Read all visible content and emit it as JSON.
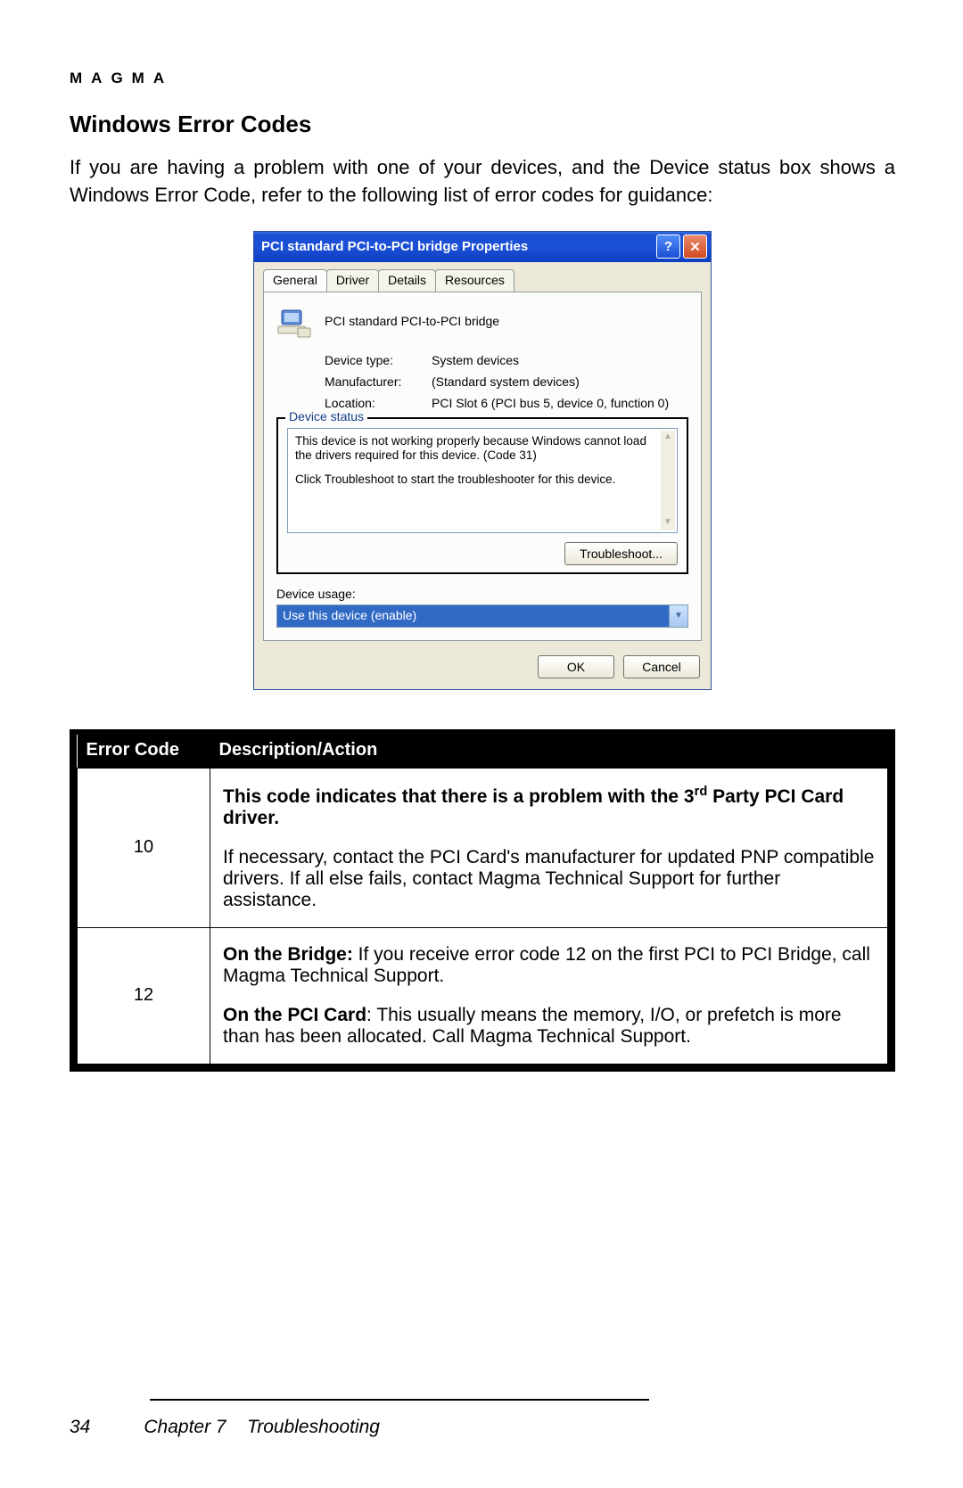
{
  "brand": "MAGMA",
  "section_title": "Windows Error Codes",
  "intro": "If you are having a problem with one of your devices, and the Device status box shows a Windows Error Code, refer to the following list of error codes for guidance:",
  "dialog": {
    "title": "PCI standard PCI-to-PCI bridge Properties",
    "tabs": [
      "General",
      "Driver",
      "Details",
      "Resources"
    ],
    "device_name": "PCI standard PCI-to-PCI bridge",
    "fields": {
      "device_type_label": "Device type:",
      "device_type_value": "System devices",
      "manufacturer_label": "Manufacturer:",
      "manufacturer_value": "(Standard system devices)",
      "location_label": "Location:",
      "location_value": "PCI Slot 6 (PCI bus 5, device 0, function 0)"
    },
    "status_group_label": "Device status",
    "status_line1": "This device is not working properly because Windows cannot load the drivers required for this device. (Code 31)",
    "status_line2": "Click Troubleshoot to start the troubleshooter for this device.",
    "troubleshoot_label": "Troubleshoot...",
    "usage_label": "Device usage:",
    "usage_value": "Use this device (enable)",
    "ok_label": "OK",
    "cancel_label": "Cancel"
  },
  "table": {
    "header_code": "Error Code",
    "header_desc": "Description/Action",
    "rows": [
      {
        "code": "10",
        "bold_a": "This code indicates that there is a problem with the 3",
        "bold_sup": "rd",
        "bold_b": " Party PCI Card driver.",
        "body": "If necessary, contact the PCI Card's manufacturer for updated PNP compatible drivers. If all else fails, contact Magma Technical Support for further assistance."
      },
      {
        "code": "12",
        "r2_b1_label": "On the Bridge:",
        "r2_b1_text": " If you receive error code 12 on the first PCI to PCI Bridge, call Magma Technical Support.",
        "r2_b2_label": "On the PCI Card",
        "r2_b2_text": ": This usually means the memory, I/O, or prefetch is more than has been allocated. Call Magma Technical Support."
      }
    ]
  },
  "footer": {
    "page_num": "34",
    "chapter": "Chapter 7",
    "chapter_title": "Troubleshooting"
  }
}
